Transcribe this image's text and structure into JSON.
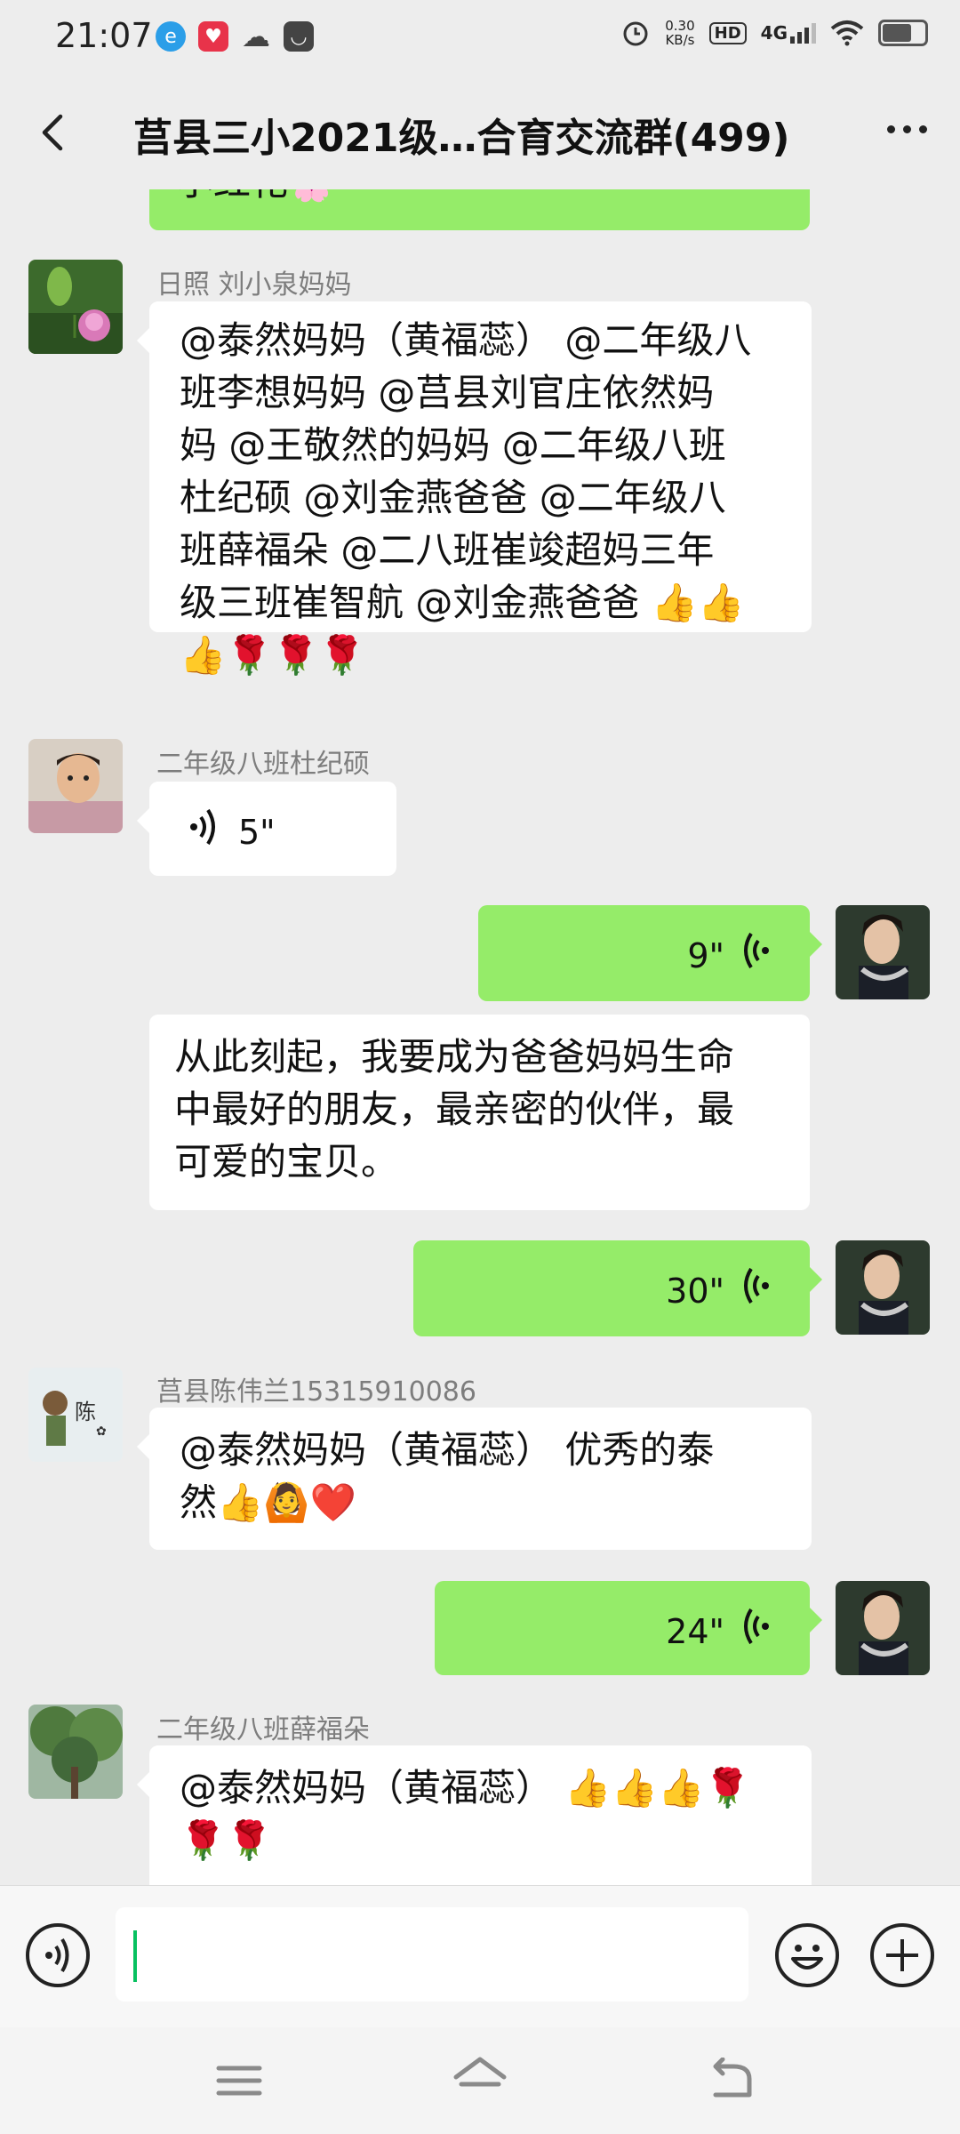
{
  "status_bar": {
    "time": "21:07",
    "network_speed_value": "0.30",
    "network_speed_unit": "KB/s",
    "hd_label": "HD",
    "network_type": "4G",
    "notification_icons": [
      "browser-icon",
      "health-app-icon",
      "weather-cloud-icon",
      "message-box-icon"
    ],
    "right_icons": [
      "alarm-icon",
      "hd-icon",
      "signal-icon",
      "wifi-icon",
      "battery-icon"
    ]
  },
  "header": {
    "back_icon": "chevron-left-icon",
    "title": "莒县三小2021级…合育交流群(499)",
    "more_icon": "more-dots-icon"
  },
  "messages": [
    {
      "type": "text",
      "side": "right",
      "partial": true,
      "text": "小红花🌸"
    },
    {
      "type": "text",
      "side": "left",
      "sender": "日照  刘小泉妈妈",
      "lines": [
        "@泰然妈妈（黄福蕊） @二年级八",
        "班李想妈妈  @莒县刘官庄依然妈",
        "妈  @王敬然的妈妈  @二年级八班",
        "杜纪硕  @刘金燕爸爸  @二年级八",
        "班薛福朵  @二八班崔竣超妈三年",
        "级三班崔智航  @刘金燕爸爸 👍👍",
        "👍🌹🌹🌹"
      ]
    },
    {
      "type": "voice",
      "side": "left",
      "sender": "二年级八班杜纪硕",
      "duration": "5\""
    },
    {
      "type": "voice",
      "side": "right",
      "duration": "9\""
    },
    {
      "type": "text",
      "side": "left",
      "lines": [
        "从此刻起，我要成为爸爸妈妈生命",
        "中最好的朋友，最亲密的伙伴，最",
        "可爱的宝贝。"
      ]
    },
    {
      "type": "voice",
      "side": "right",
      "duration": "30\""
    },
    {
      "type": "text",
      "side": "left",
      "sender": "莒县陈伟兰15315910086",
      "lines": [
        "@泰然妈妈（黄福蕊）  优秀的泰",
        "然👍🙆❤️"
      ]
    },
    {
      "type": "voice",
      "side": "right",
      "duration": "24\""
    },
    {
      "type": "text",
      "side": "left",
      "sender": "二年级八班薛福朵",
      "lines": [
        "@泰然妈妈（黄福蕊） 👍👍👍🌹",
        "🌹🌹"
      ]
    }
  ],
  "input_bar": {
    "voice_icon": "voice-input-icon",
    "input_value": "",
    "emoji_icon": "emoji-smile-icon",
    "plus_icon": "plus-icon"
  },
  "nav_bar": {
    "menu_icon": "menu-icon",
    "home_icon": "home-icon",
    "back_icon": "back-arrow-icon"
  },
  "colors": {
    "background": "#ededed",
    "bubble_green": "#95ec69",
    "bubble_white": "#ffffff",
    "sender_gray": "#7d7d7d",
    "caret_green": "#07c160"
  }
}
